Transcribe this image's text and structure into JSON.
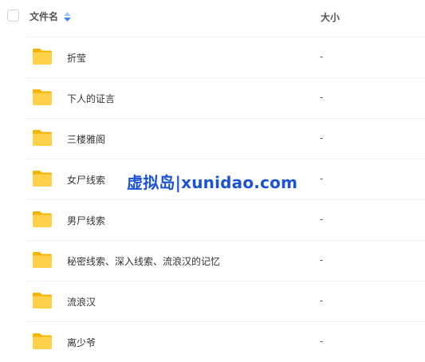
{
  "header": {
    "name_label": "文件名",
    "size_label": "大小"
  },
  "rows": [
    {
      "name": "折莹",
      "size": "-",
      "icon": "folder-icon"
    },
    {
      "name": "下人的证言",
      "size": "-",
      "icon": "folder-icon"
    },
    {
      "name": "三楼雅阁",
      "size": "-",
      "icon": "folder-icon"
    },
    {
      "name": "女尸线索",
      "size": "-",
      "icon": "folder-icon"
    },
    {
      "name": "男尸线索",
      "size": "-",
      "icon": "folder-icon"
    },
    {
      "name": "秘密线索、深入线索、流浪汉的记忆",
      "size": "-",
      "icon": "folder-icon"
    },
    {
      "name": "流浪汉",
      "size": "-",
      "icon": "folder-icon"
    },
    {
      "name": "离少爷",
      "size": "-",
      "icon": "folder-icon"
    }
  ],
  "watermark": "虚拟岛|xunidao.com",
  "colors": {
    "folder": "#ffc93a",
    "sort_icon_up": "#a6c8ff",
    "sort_icon_down": "#3b82f6",
    "watermark": "#1c53d6"
  }
}
